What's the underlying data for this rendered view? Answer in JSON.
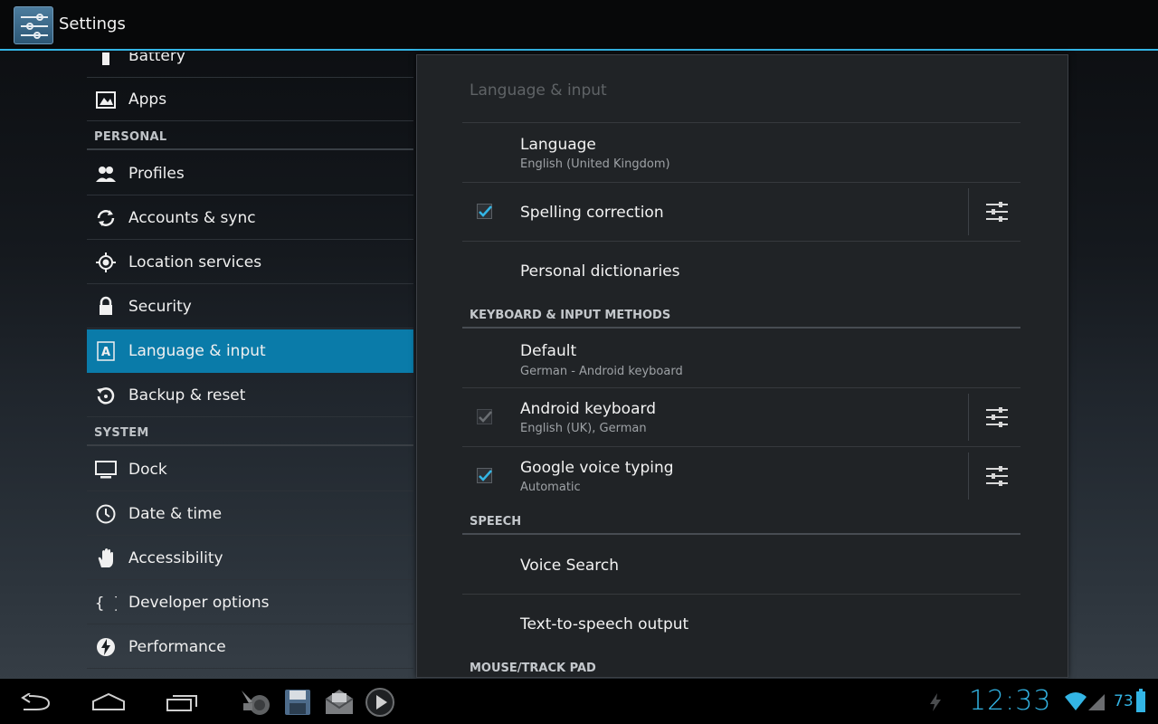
{
  "actionbar": {
    "title": "Settings"
  },
  "left_list": [
    {
      "kind": "item",
      "label": "Battery",
      "icon": "battery-icon"
    },
    {
      "kind": "item",
      "label": "Apps",
      "icon": "apps-icon"
    },
    {
      "kind": "header",
      "label": "PERSONAL"
    },
    {
      "kind": "item",
      "label": "Profiles",
      "icon": "profiles-icon"
    },
    {
      "kind": "item",
      "label": "Accounts & sync",
      "icon": "sync-icon"
    },
    {
      "kind": "item",
      "label": "Location services",
      "icon": "location-icon"
    },
    {
      "kind": "item",
      "label": "Security",
      "icon": "lock-icon"
    },
    {
      "kind": "item",
      "label": "Language & input",
      "icon": "language-icon",
      "selected": true
    },
    {
      "kind": "item",
      "label": "Backup & reset",
      "icon": "backup-icon"
    },
    {
      "kind": "header",
      "label": "SYSTEM"
    },
    {
      "kind": "item",
      "label": "Dock",
      "icon": "dock-icon"
    },
    {
      "kind": "item",
      "label": "Date & time",
      "icon": "clock-icon"
    },
    {
      "kind": "item",
      "label": "Accessibility",
      "icon": "hand-icon"
    },
    {
      "kind": "item",
      "label": "Developer options",
      "icon": "braces-icon"
    },
    {
      "kind": "item",
      "label": "Performance",
      "icon": "performance-icon"
    }
  ],
  "panel": {
    "title": "Language & input",
    "language": {
      "title": "Language",
      "sub": "English (United Kingdom)"
    },
    "spelling": {
      "title": "Spelling correction",
      "checked": true
    },
    "dictionaries": {
      "title": "Personal dictionaries"
    },
    "keyboard_header": "KEYBOARD & INPUT METHODS",
    "default_method": {
      "title": "Default",
      "sub": "German - Android keyboard"
    },
    "android_keyboard": {
      "title": "Android keyboard",
      "sub": "English (UK), German",
      "checked": true,
      "enabled": false
    },
    "google_voice": {
      "title": "Google voice typing",
      "sub": "Automatic",
      "checked": true
    },
    "speech_header": "SPEECH",
    "voice_search": {
      "title": "Voice Search"
    },
    "tts": {
      "title": "Text-to-speech output"
    },
    "mouse_header": "MOUSE/TRACK PAD"
  },
  "status": {
    "time": "12:33",
    "battery": "73"
  },
  "colors": {
    "accent": "#33b5e5",
    "selected": "#0a7ba9"
  }
}
